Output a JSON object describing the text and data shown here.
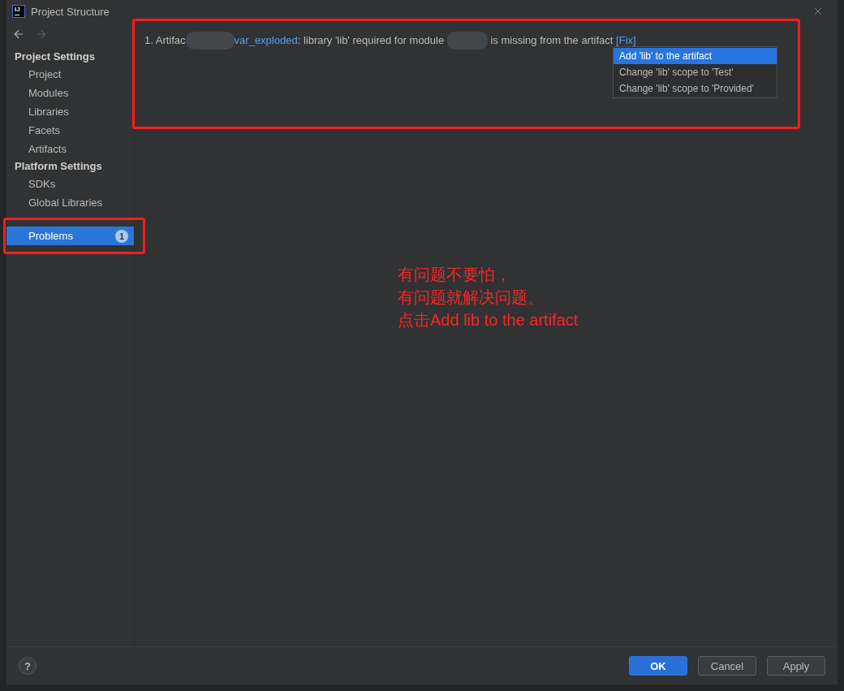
{
  "window": {
    "logo": "IJ",
    "title": "Project Structure"
  },
  "navigation": [
    {
      "kind": "back",
      "disabled": false
    },
    {
      "kind": "forward",
      "disabled": true
    }
  ],
  "sidebar": {
    "sections": [
      {
        "heading": "Project Settings",
        "items": [
          {
            "label": "Project",
            "selected": false
          },
          {
            "label": "Modules",
            "selected": false
          },
          {
            "label": "Libraries",
            "selected": false
          },
          {
            "label": "Facets",
            "selected": false
          },
          {
            "label": "Artifacts",
            "selected": false
          }
        ]
      },
      {
        "heading": "Platform Settings",
        "items": [
          {
            "label": "SDKs",
            "selected": false
          },
          {
            "label": "Global Libraries",
            "selected": false
          }
        ]
      }
    ],
    "problems": {
      "label": "Problems",
      "badge": "1",
      "selected": true
    }
  },
  "problems": [
    {
      "number": "1.",
      "prefix": "Artifac",
      "artifact_link": "var_exploded",
      "detail": ": library 'lib' required for module",
      "suffix": "is missing from the artifact",
      "fix_link": "[Fix]"
    }
  ],
  "fix_menu": {
    "items": [
      {
        "label": "Add 'lib' to the artifact",
        "selected": true
      },
      {
        "label": "Change 'lib' scope to 'Test'",
        "selected": false
      },
      {
        "label": "Change 'lib' scope to 'Provided'",
        "selected": false
      }
    ]
  },
  "annotation": {
    "lines": [
      "有问题不要怕，",
      "有问题就解决问题。",
      "点击Add lib to the artifact"
    ]
  },
  "footer": {
    "help": "?",
    "buttons": [
      {
        "label": "OK",
        "kind": "primary"
      },
      {
        "label": "Cancel",
        "kind": "secondary"
      },
      {
        "label": "Apply",
        "kind": "secondary"
      }
    ]
  }
}
